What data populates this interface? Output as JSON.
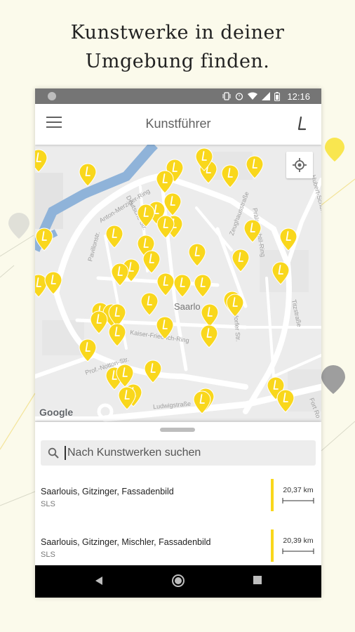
{
  "headline": {
    "line1": "Kunstwerke in deiner",
    "line2": "Umgebung finden."
  },
  "statusbar": {
    "time": "12:16",
    "icons": [
      "vibrate-icon",
      "alarm-icon",
      "wifi-icon",
      "signal-icon",
      "battery-icon"
    ]
  },
  "appbar": {
    "title": "Kunstführer",
    "menu_icon": "hamburger-menu-icon",
    "logo_icon": "kunstfuehrer-logo-icon"
  },
  "map": {
    "attribution": "Google",
    "city_label": "Saarlo",
    "street_labels": [
      "Anton-Merziger-Ring",
      "Deutsche Str.",
      "Zeughausstraße",
      "Prof.-Notton-Str.",
      "Kaiser-Friedrich-Ring",
      "Ludwigstraße",
      "Lisdorfer Str.",
      "Titzstraße",
      "Prälat-Subtil-Ring",
      "Pavillonstr.",
      "Fort Ro",
      "Hubert-Schuh"
    ],
    "locate_icon": "my-location-icon",
    "pin_icon": "artwork-pin-icon",
    "pin_color": "#f9d71c"
  },
  "search": {
    "placeholder": "Nach Kunstwerken suchen",
    "icon": "search-icon"
  },
  "results": [
    {
      "title": "Saarlouis, Gitzinger, Fassadenbild",
      "subtitle": "SLS",
      "distance": "20,37 km"
    },
    {
      "title": "Saarlouis, Gitzinger, Mischler, Fassadenbild",
      "subtitle": "SLS",
      "distance": "20,39 km"
    }
  ],
  "navbar": {
    "back_icon": "back-triangle-icon",
    "home_icon": "home-circle-icon",
    "recents_icon": "recents-square-icon"
  },
  "colors": {
    "accent_yellow": "#f9d71c",
    "page_background": "#fbfaeb",
    "river_blue": "#8fb3d9"
  }
}
